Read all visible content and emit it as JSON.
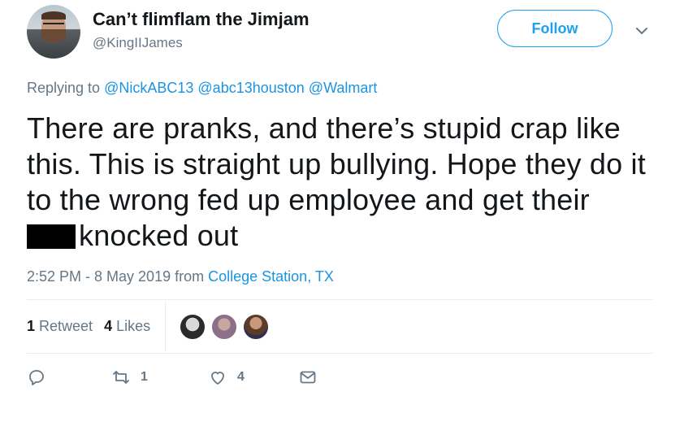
{
  "user": {
    "name": "Can’t flimflam the Jimjam",
    "handle": "@KingIIJames"
  },
  "follow_label": "Follow",
  "reply": {
    "prefix": "Replying to",
    "mentions": [
      "@NickABC13",
      "@abc13houston",
      "@Walmart"
    ]
  },
  "tweet": {
    "text_main": "There are pranks, and there’s stupid crap like this. This is straight up bullying. Hope they do it to the wrong fed up employee and get their",
    "text_tail": "knocked out"
  },
  "meta": {
    "time_date": "2:52 PM - 8 May 2019 from",
    "location": "College Station, TX"
  },
  "stats": {
    "retweets_count": "1",
    "retweets_label": "Retweet",
    "likes_count": "4",
    "likes_label": "Likes"
  },
  "actions": {
    "retweet_count": "1",
    "like_count": "4"
  },
  "colors": {
    "accent": "#1da1f2",
    "link": "#1b95e0",
    "muted": "#657786",
    "text": "#14171a"
  }
}
